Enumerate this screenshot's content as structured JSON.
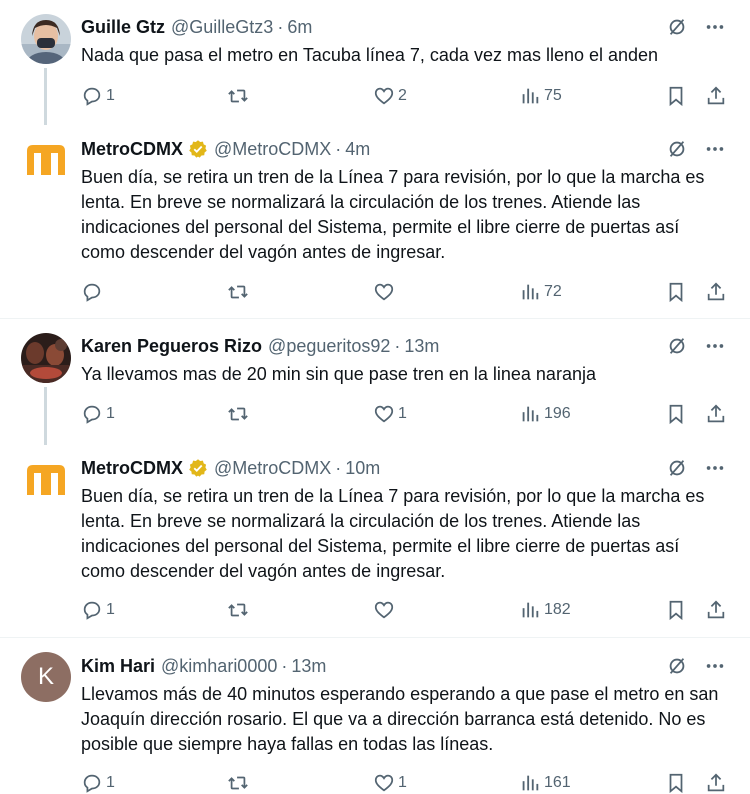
{
  "tweets": [
    {
      "name": "Guille Gtz",
      "handle": "@GuilleGtz3",
      "time": "6m",
      "text": "Nada que pasa el metro en Tacuba línea 7, cada vez mas lleno el anden",
      "replies": "1",
      "retweets": "",
      "likes": "2",
      "views": "75",
      "avatar": "photo-avatar-woman-mask"
    },
    {
      "name": "MetroCDMX",
      "handle": "@MetroCDMX",
      "time": "4m",
      "text": "Buen día, se retira un tren de la Línea 7 para revisión, por lo que la marcha es lenta. En breve se normalizará la circulación de los trenes. Atiende las indicaciones del personal del Sistema, permite el libre cierre de puertas así como descender del vagón antes de ingresar.",
      "replies": "",
      "retweets": "",
      "likes": "",
      "views": "72",
      "avatar": "metro-logo"
    },
    {
      "name": "Karen Pegueros Rizo",
      "handle": "@pegueritos92",
      "time": "13m",
      "text": "Ya llevamos mas de 20 min sin que pase tren en la linea naranja",
      "replies": "1",
      "retweets": "",
      "likes": "1",
      "views": "196",
      "avatar": "photo-avatar-dark"
    },
    {
      "name": "MetroCDMX",
      "handle": "@MetroCDMX",
      "time": "10m",
      "text": "Buen día, se retira un tren de la Línea 7 para revisión, por lo que la marcha es lenta. En breve se normalizará la circulación de los trenes. Atiende las indicaciones del personal del Sistema, permite el libre cierre de puertas así como descender del vagón antes de ingresar.",
      "replies": "1",
      "retweets": "",
      "likes": "",
      "views": "182",
      "avatar": "metro-logo"
    },
    {
      "name": "Kim Hari",
      "handle": "@kimhari0000",
      "time": "13m",
      "text": "Llevamos más de 40 minutos esperando esperando a que pase el metro en san Joaquín dirección rosario. El que va a dirección barranca está detenido. No es posible que siempre haya fallas en todas las líneas.",
      "replies": "1",
      "retweets": "",
      "likes": "1",
      "views": "161",
      "avatar": "letter-avatar",
      "avatar_letter": "K"
    }
  ],
  "colors": {
    "text": "#0f1419",
    "secondary": "#536471",
    "thread_line": "#cfd9de",
    "separator": "#eff3f4",
    "metro_orange": "#f5a623",
    "verified_gold": "#e2b719",
    "letter_avatar_bg": "#8d6e63"
  },
  "icons": [
    "grok-icon",
    "more-icon",
    "reply-icon",
    "retweet-icon",
    "like-icon",
    "views-icon",
    "bookmark-icon",
    "share-icon"
  ]
}
